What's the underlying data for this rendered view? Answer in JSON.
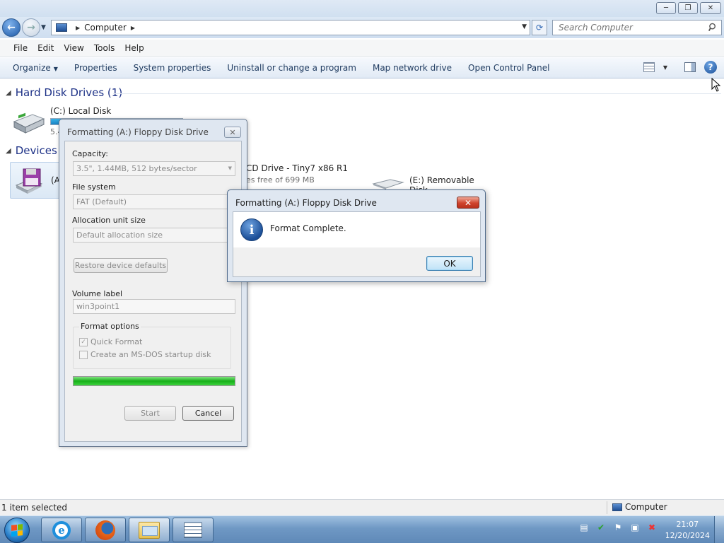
{
  "window": {
    "minimize": "─",
    "maximize": "❐",
    "close": "✕"
  },
  "nav": {
    "back_glyph": "←",
    "forward_glyph": "→",
    "address": "Computer",
    "search_placeholder": "Search Computer"
  },
  "menu": [
    "File",
    "Edit",
    "View",
    "Tools",
    "Help"
  ],
  "commands": {
    "organize": "Organize",
    "items": [
      "System properties",
      "Uninstall or change a program",
      "Map network drive",
      "Open Control Panel"
    ],
    "properties": "Properties"
  },
  "content": {
    "hdd_group": "Hard Disk Drives (1)",
    "removable_group": "Devices w",
    "drive_c": {
      "name": "(C:) Local Disk",
      "sub": "5.4",
      "usage_fraction": 0.22
    },
    "floppy_label": "(A",
    "cd_name": "CD Drive - Tiny7 x86 R1",
    "cd_sub": "es free of 699 MB",
    "removable_label": "(E:) Removable Disk"
  },
  "format_dialog": {
    "title": "Formatting (A:) Floppy Disk Drive",
    "capacity_label": "Capacity:",
    "capacity_value": "3.5\",  1.44MB, 512 bytes/sector",
    "fs_label": "File system",
    "fs_value": "FAT (Default)",
    "alloc_label": "Allocation unit size",
    "alloc_value": "Default allocation size",
    "restore_button": "Restore device defaults",
    "volume_label": "Volume label",
    "volume_value": "win3point1",
    "options_label": "Format options",
    "quick_format": "Quick Format",
    "msdos": "Create an MS-DOS startup disk",
    "progress": 1.0,
    "start_button": "Start",
    "cancel_button": "Cancel"
  },
  "message": {
    "title": "Formatting (A:) Floppy Disk Drive",
    "text": "Format Complete.",
    "ok": "OK"
  },
  "status": {
    "left": "1 item selected",
    "right": "Computer"
  },
  "clock": {
    "time": "21:07",
    "date": "12/20/2024"
  },
  "colors": {
    "accent": "#1e3287",
    "progress": "#18b01a",
    "close_red": "#d0442c"
  }
}
